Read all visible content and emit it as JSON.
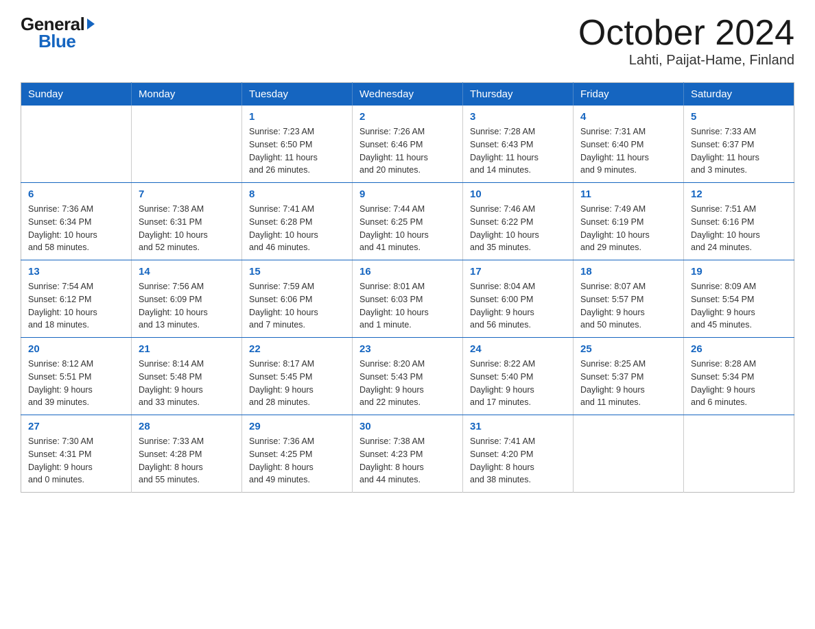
{
  "logo": {
    "general": "General",
    "blue": "Blue"
  },
  "title": "October 2024",
  "subtitle": "Lahti, Paijat-Hame, Finland",
  "headers": [
    "Sunday",
    "Monday",
    "Tuesday",
    "Wednesday",
    "Thursday",
    "Friday",
    "Saturday"
  ],
  "weeks": [
    [
      {
        "day": "",
        "info": ""
      },
      {
        "day": "",
        "info": ""
      },
      {
        "day": "1",
        "info": "Sunrise: 7:23 AM\nSunset: 6:50 PM\nDaylight: 11 hours\nand 26 minutes."
      },
      {
        "day": "2",
        "info": "Sunrise: 7:26 AM\nSunset: 6:46 PM\nDaylight: 11 hours\nand 20 minutes."
      },
      {
        "day": "3",
        "info": "Sunrise: 7:28 AM\nSunset: 6:43 PM\nDaylight: 11 hours\nand 14 minutes."
      },
      {
        "day": "4",
        "info": "Sunrise: 7:31 AM\nSunset: 6:40 PM\nDaylight: 11 hours\nand 9 minutes."
      },
      {
        "day": "5",
        "info": "Sunrise: 7:33 AM\nSunset: 6:37 PM\nDaylight: 11 hours\nand 3 minutes."
      }
    ],
    [
      {
        "day": "6",
        "info": "Sunrise: 7:36 AM\nSunset: 6:34 PM\nDaylight: 10 hours\nand 58 minutes."
      },
      {
        "day": "7",
        "info": "Sunrise: 7:38 AM\nSunset: 6:31 PM\nDaylight: 10 hours\nand 52 minutes."
      },
      {
        "day": "8",
        "info": "Sunrise: 7:41 AM\nSunset: 6:28 PM\nDaylight: 10 hours\nand 46 minutes."
      },
      {
        "day": "9",
        "info": "Sunrise: 7:44 AM\nSunset: 6:25 PM\nDaylight: 10 hours\nand 41 minutes."
      },
      {
        "day": "10",
        "info": "Sunrise: 7:46 AM\nSunset: 6:22 PM\nDaylight: 10 hours\nand 35 minutes."
      },
      {
        "day": "11",
        "info": "Sunrise: 7:49 AM\nSunset: 6:19 PM\nDaylight: 10 hours\nand 29 minutes."
      },
      {
        "day": "12",
        "info": "Sunrise: 7:51 AM\nSunset: 6:16 PM\nDaylight: 10 hours\nand 24 minutes."
      }
    ],
    [
      {
        "day": "13",
        "info": "Sunrise: 7:54 AM\nSunset: 6:12 PM\nDaylight: 10 hours\nand 18 minutes."
      },
      {
        "day": "14",
        "info": "Sunrise: 7:56 AM\nSunset: 6:09 PM\nDaylight: 10 hours\nand 13 minutes."
      },
      {
        "day": "15",
        "info": "Sunrise: 7:59 AM\nSunset: 6:06 PM\nDaylight: 10 hours\nand 7 minutes."
      },
      {
        "day": "16",
        "info": "Sunrise: 8:01 AM\nSunset: 6:03 PM\nDaylight: 10 hours\nand 1 minute."
      },
      {
        "day": "17",
        "info": "Sunrise: 8:04 AM\nSunset: 6:00 PM\nDaylight: 9 hours\nand 56 minutes."
      },
      {
        "day": "18",
        "info": "Sunrise: 8:07 AM\nSunset: 5:57 PM\nDaylight: 9 hours\nand 50 minutes."
      },
      {
        "day": "19",
        "info": "Sunrise: 8:09 AM\nSunset: 5:54 PM\nDaylight: 9 hours\nand 45 minutes."
      }
    ],
    [
      {
        "day": "20",
        "info": "Sunrise: 8:12 AM\nSunset: 5:51 PM\nDaylight: 9 hours\nand 39 minutes."
      },
      {
        "day": "21",
        "info": "Sunrise: 8:14 AM\nSunset: 5:48 PM\nDaylight: 9 hours\nand 33 minutes."
      },
      {
        "day": "22",
        "info": "Sunrise: 8:17 AM\nSunset: 5:45 PM\nDaylight: 9 hours\nand 28 minutes."
      },
      {
        "day": "23",
        "info": "Sunrise: 8:20 AM\nSunset: 5:43 PM\nDaylight: 9 hours\nand 22 minutes."
      },
      {
        "day": "24",
        "info": "Sunrise: 8:22 AM\nSunset: 5:40 PM\nDaylight: 9 hours\nand 17 minutes."
      },
      {
        "day": "25",
        "info": "Sunrise: 8:25 AM\nSunset: 5:37 PM\nDaylight: 9 hours\nand 11 minutes."
      },
      {
        "day": "26",
        "info": "Sunrise: 8:28 AM\nSunset: 5:34 PM\nDaylight: 9 hours\nand 6 minutes."
      }
    ],
    [
      {
        "day": "27",
        "info": "Sunrise: 7:30 AM\nSunset: 4:31 PM\nDaylight: 9 hours\nand 0 minutes."
      },
      {
        "day": "28",
        "info": "Sunrise: 7:33 AM\nSunset: 4:28 PM\nDaylight: 8 hours\nand 55 minutes."
      },
      {
        "day": "29",
        "info": "Sunrise: 7:36 AM\nSunset: 4:25 PM\nDaylight: 8 hours\nand 49 minutes."
      },
      {
        "day": "30",
        "info": "Sunrise: 7:38 AM\nSunset: 4:23 PM\nDaylight: 8 hours\nand 44 minutes."
      },
      {
        "day": "31",
        "info": "Sunrise: 7:41 AM\nSunset: 4:20 PM\nDaylight: 8 hours\nand 38 minutes."
      },
      {
        "day": "",
        "info": ""
      },
      {
        "day": "",
        "info": ""
      }
    ]
  ]
}
